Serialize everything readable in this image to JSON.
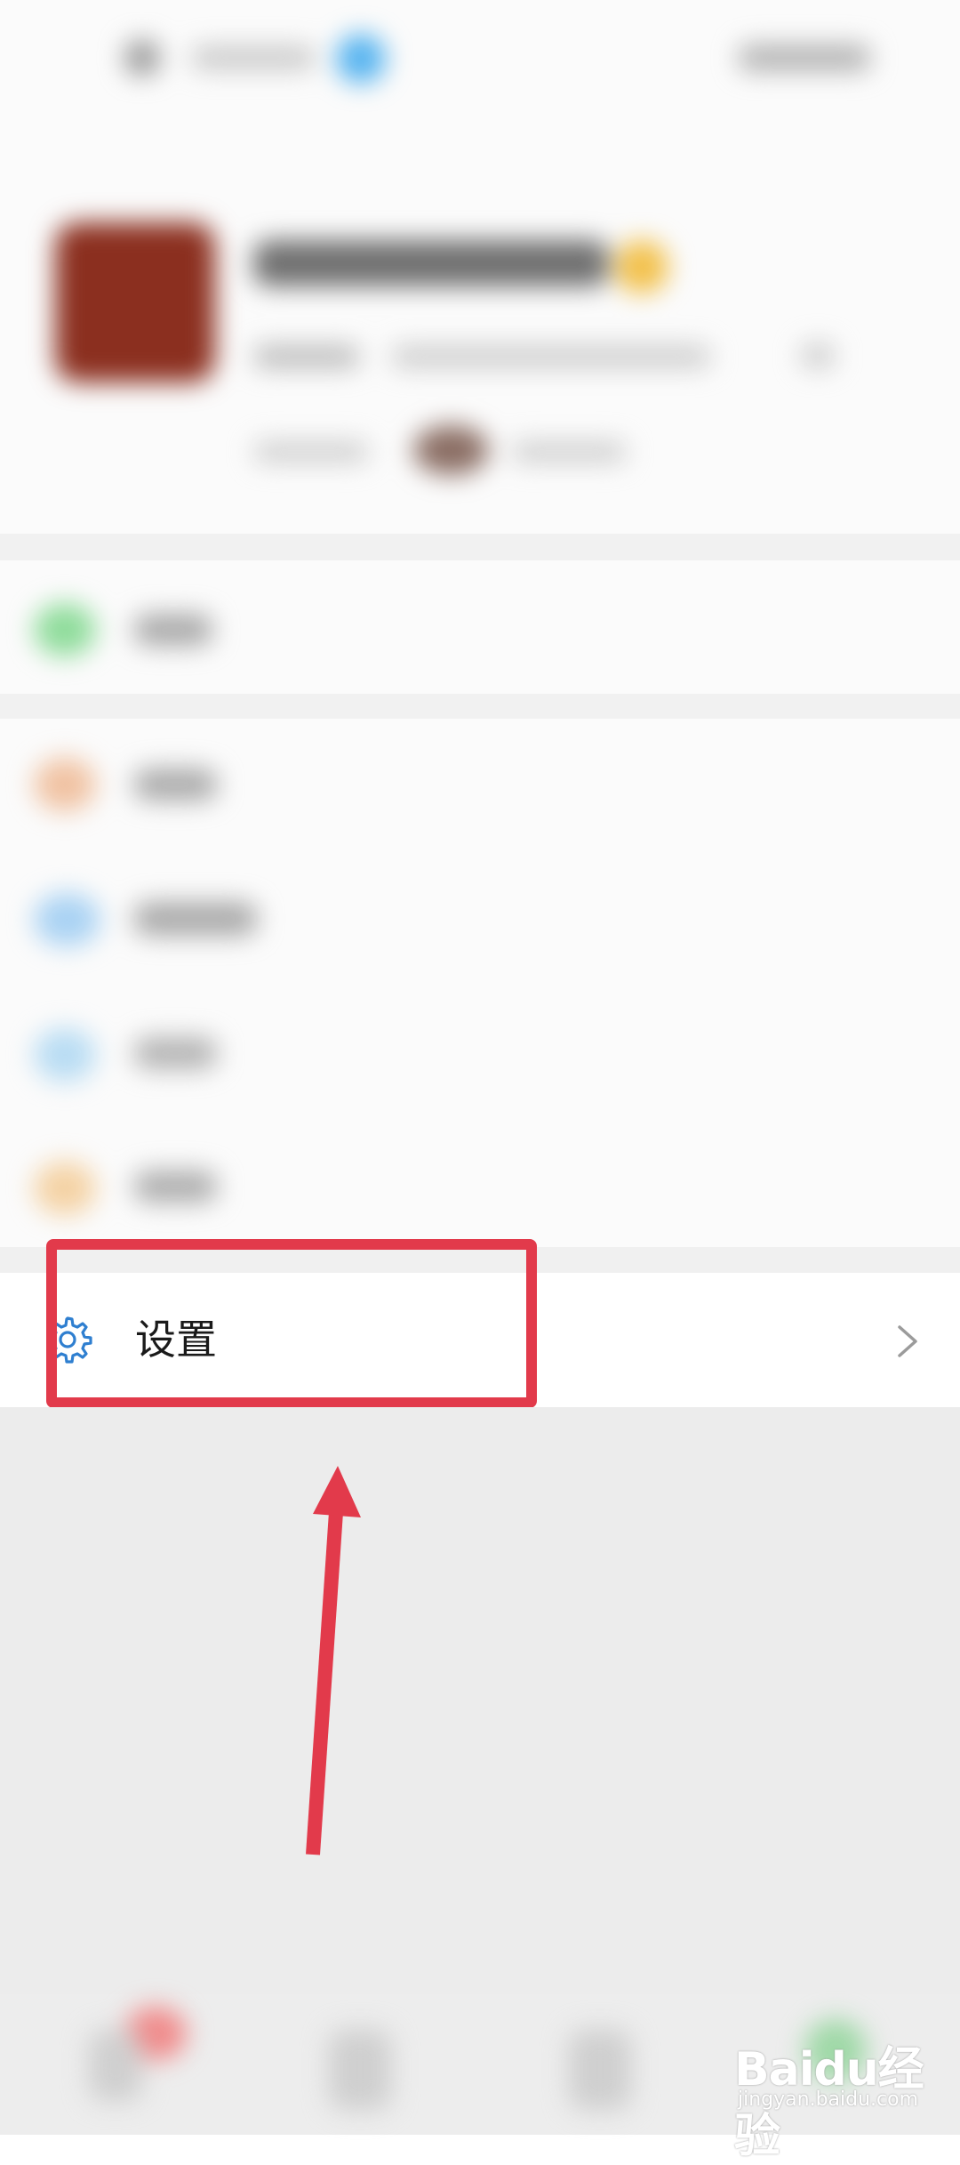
{
  "settings_row": {
    "label": "设置",
    "icon": "gear-icon",
    "chevron": "chevron-right-icon"
  },
  "annotation": {
    "highlight_color": "#e23a4b"
  },
  "watermark": {
    "brand": "Baidu经验",
    "url": "jingyan.baidu.com"
  }
}
